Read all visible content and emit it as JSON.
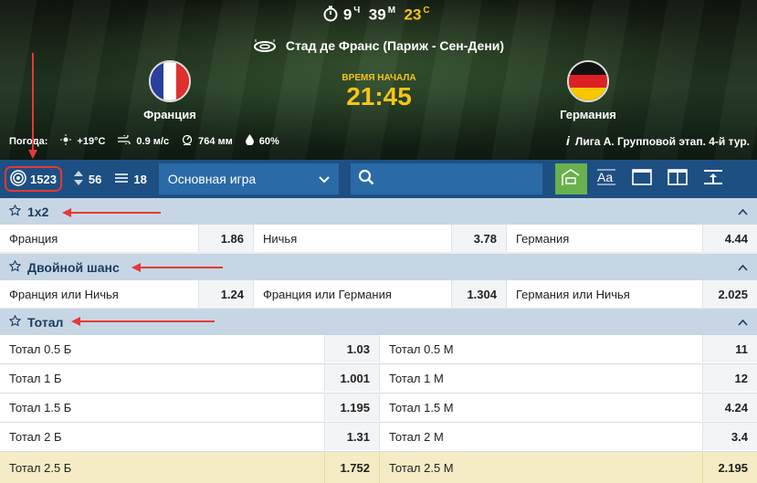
{
  "header": {
    "timer": {
      "h": "9",
      "h_unit": "Ч",
      "m": "39",
      "m_unit": "М",
      "s": "23",
      "s_unit": "С"
    },
    "stadium": "Стад де Франс (Париж - Сен-Дени)",
    "team1": {
      "name": "Франция"
    },
    "team2": {
      "name": "Германия"
    },
    "start_label": "ВРЕМЯ НАЧАЛА",
    "start_time": "21:45",
    "weather": {
      "label": "Погода:",
      "temp": "+19°C",
      "wind": "0.9 м/с",
      "pressure": "764 мм",
      "humidity": "60%"
    },
    "league": "Лига А. Групповой этап. 4-й тур."
  },
  "toolbar": {
    "all_count": "1523",
    "count2": "56",
    "count3": "18",
    "game_select": "Основная игра"
  },
  "markets": {
    "m1x2": {
      "title": "1x2",
      "cells": [
        {
          "label": "Франция",
          "odd": "1.86"
        },
        {
          "label": "Ничья",
          "odd": "3.78"
        },
        {
          "label": "Германия",
          "odd": "4.44"
        }
      ]
    },
    "double": {
      "title": "Двойной шанс",
      "cells": [
        {
          "label": "Франция или Ничья",
          "odd": "1.24"
        },
        {
          "label": "Франция или Германия",
          "odd": "1.304"
        },
        {
          "label": "Германия или Ничья",
          "odd": "2.025"
        }
      ]
    },
    "total": {
      "title": "Тотал",
      "rows": [
        {
          "over": "Тотал 0.5 Б",
          "over_odd": "1.03",
          "under": "Тотал 0.5 М",
          "under_odd": "11"
        },
        {
          "over": "Тотал 1 Б",
          "over_odd": "1.001",
          "under": "Тотал 1 М",
          "under_odd": "12"
        },
        {
          "over": "Тотал 1.5 Б",
          "over_odd": "1.195",
          "under": "Тотал 1.5 М",
          "under_odd": "4.24"
        },
        {
          "over": "Тотал 2 Б",
          "over_odd": "1.31",
          "under": "Тотал 2 М",
          "under_odd": "3.4"
        },
        {
          "over": "Тотал 2.5 Б",
          "over_odd": "1.752",
          "under": "Тотал 2.5 М",
          "under_odd": "2.195"
        }
      ]
    }
  },
  "colors": {
    "toolbar_bg": "#1e4f82",
    "accent_yellow": "#f5c518",
    "active_green": "#6ab04c",
    "annotation_red": "#e53935",
    "highlight_row": "#f5ebc4"
  }
}
